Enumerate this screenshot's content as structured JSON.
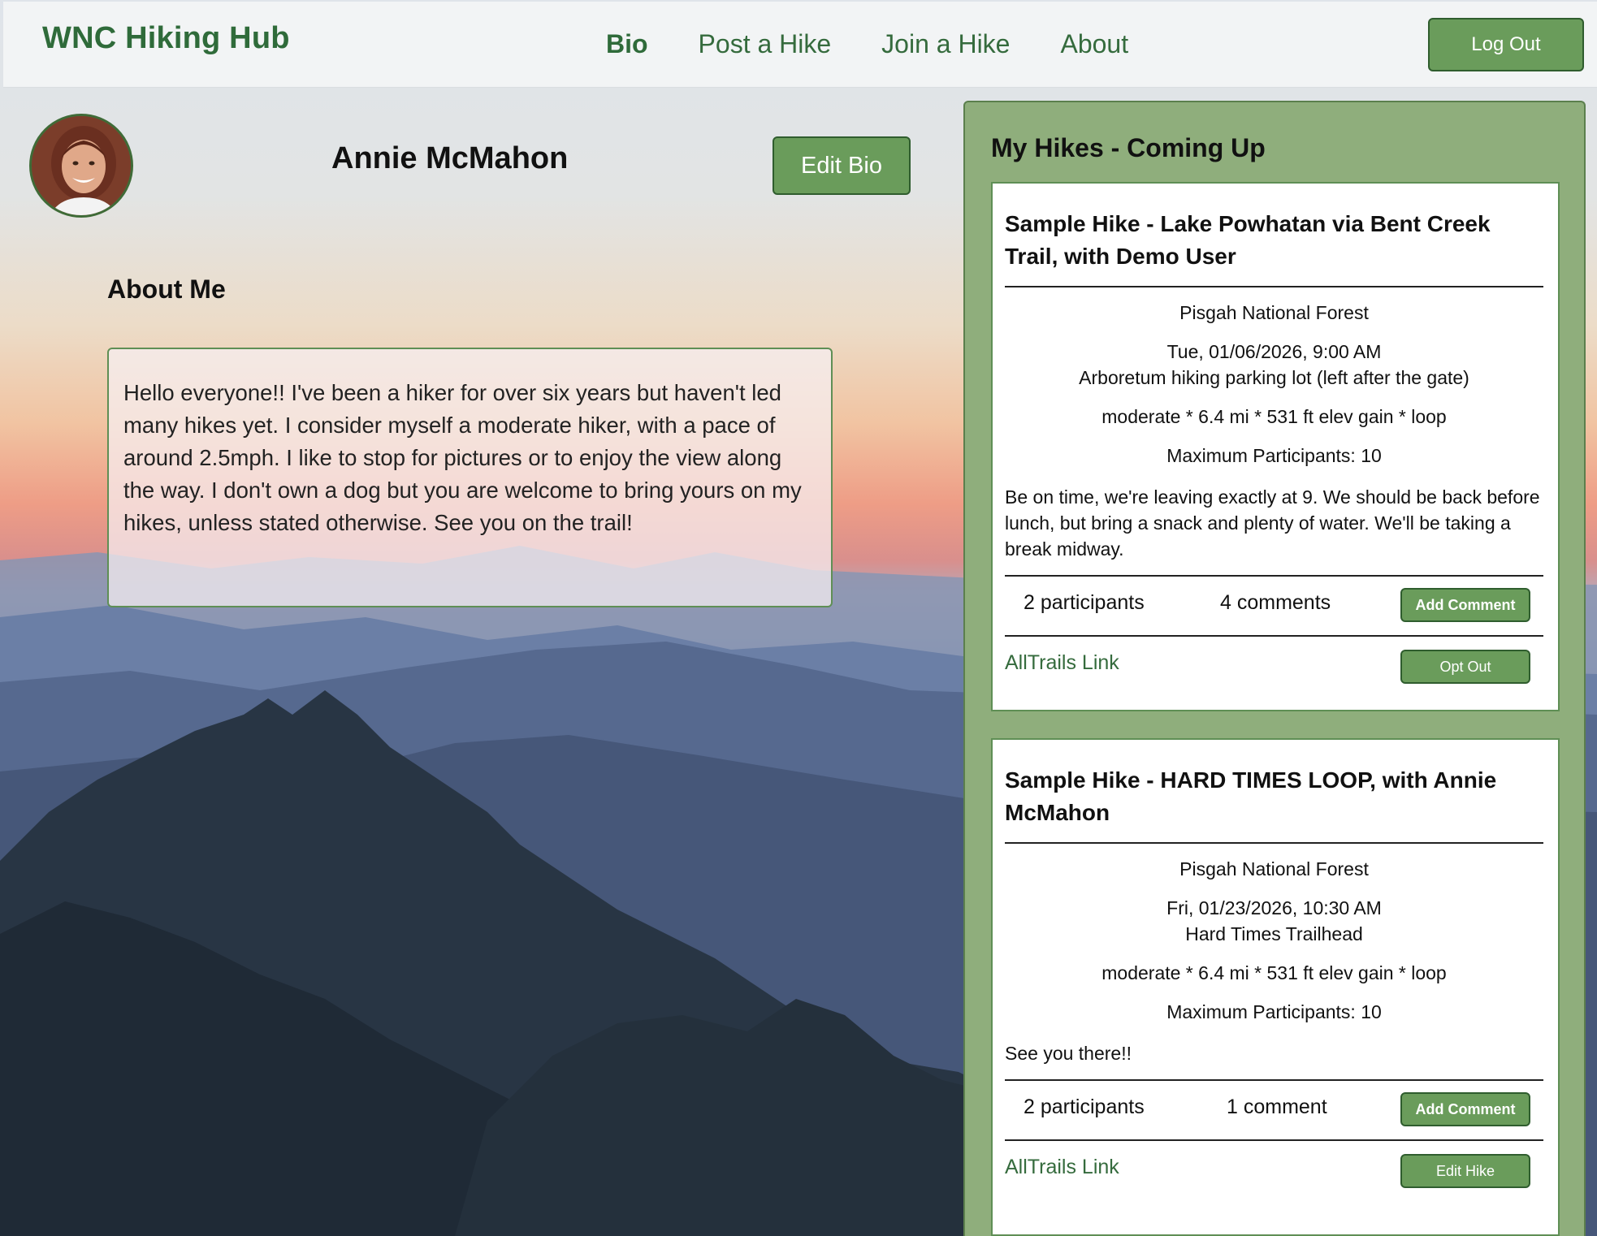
{
  "header": {
    "brand": "WNC Hiking Hub",
    "nav": [
      "Bio",
      "Post a Hike",
      "Join a Hike",
      "About"
    ],
    "active_nav": "Bio",
    "logout_label": "Log Out"
  },
  "profile": {
    "name": "Annie McMahon",
    "edit_label": "Edit Bio",
    "about_heading": "About Me",
    "bio": "Hello everyone!! I've been a hiker for over six years but haven't led many hikes yet. I consider myself a moderate hiker, with a pace of around 2.5mph. I like to stop for pictures or to enjoy the view along the way. I don't own a dog but you are welcome to bring yours on my hikes, unless stated otherwise. See you on the trail!"
  },
  "hikes_panel": {
    "title": "My Hikes - Coming Up",
    "hikes": [
      {
        "title": "Sample Hike - Lake Powhatan via Bent Creek Trail, with Demo User",
        "location": "Pisgah National Forest",
        "datetime": "Tue, 01/06/2026, 9:00 AM",
        "meeting_point": "Arboretum hiking parking lot (left after the gate)",
        "details": "moderate * 6.4 mi * 531 ft elev gain * loop",
        "max_participants": "Maximum Participants: 10",
        "description": "Be on time, we're leaving exactly at 9. We should be back before lunch, but bring a snack and plenty of water. We'll be taking a break midway.",
        "participants": "2 participants",
        "comments": "4 comments",
        "comment_button": "Add Comment",
        "link_label": "AllTrails Link",
        "action_button": "Opt Out"
      },
      {
        "title": "Sample Hike - HARD TIMES LOOP, with Annie McMahon",
        "location": "Pisgah National Forest",
        "datetime": "Fri, 01/23/2026, 10:30 AM",
        "meeting_point": "Hard Times Trailhead",
        "details": "moderate * 6.4 mi * 531 ft elev gain * loop",
        "max_participants": "Maximum Participants: 10",
        "description": "See you there!!",
        "participants": "2 participants",
        "comments": "1 comment",
        "comment_button": "Add Comment",
        "link_label": "AllTrails Link",
        "action_button": "Edit Hike"
      }
    ]
  },
  "colors": {
    "brand_green": "#2f6b3a",
    "button_green": "#6a9c5b",
    "panel_green": "#8fae7c"
  }
}
